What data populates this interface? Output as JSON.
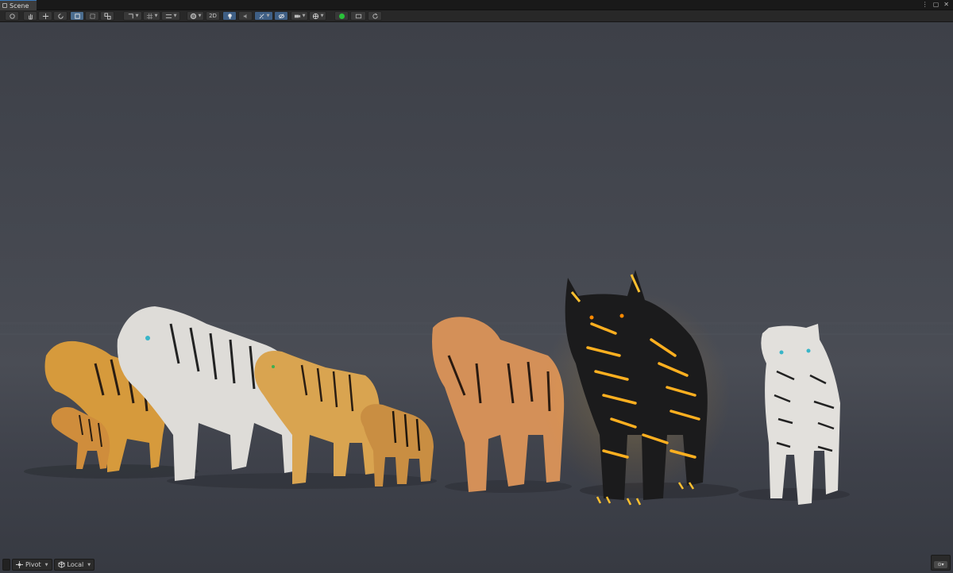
{
  "window": {
    "tab_label": "Scene",
    "controls": [
      "⋮",
      "▢",
      "✕"
    ]
  },
  "toolbar": {
    "toggle_2d_label": "2D",
    "tools": [
      "view-tool",
      "hand-tool",
      "move-tool",
      "rotate-tool",
      "scale-tool",
      "rect-tool",
      "transform-tool"
    ]
  },
  "bottom_bar": {
    "pivot_label": "Pivot",
    "local_label": "Local"
  },
  "scene": {
    "subjects": [
      {
        "name": "orange-tiger-adult",
        "color": "#d79a3a"
      },
      {
        "name": "orange-tiger-cub-left",
        "color": "#d08f3c"
      },
      {
        "name": "white-tiger-large",
        "color": "#dedcd8"
      },
      {
        "name": "golden-tiger-young",
        "color": "#d9a450"
      },
      {
        "name": "tiger-cub-center",
        "color": "#c98e42"
      },
      {
        "name": "orange-tiger-standing",
        "color": "#d49058"
      },
      {
        "name": "black-glowing-tiger",
        "color": "#1a1a1a",
        "glow": "#ffb020"
      },
      {
        "name": "white-tiger-right",
        "color": "#e2e0dc"
      }
    ]
  }
}
